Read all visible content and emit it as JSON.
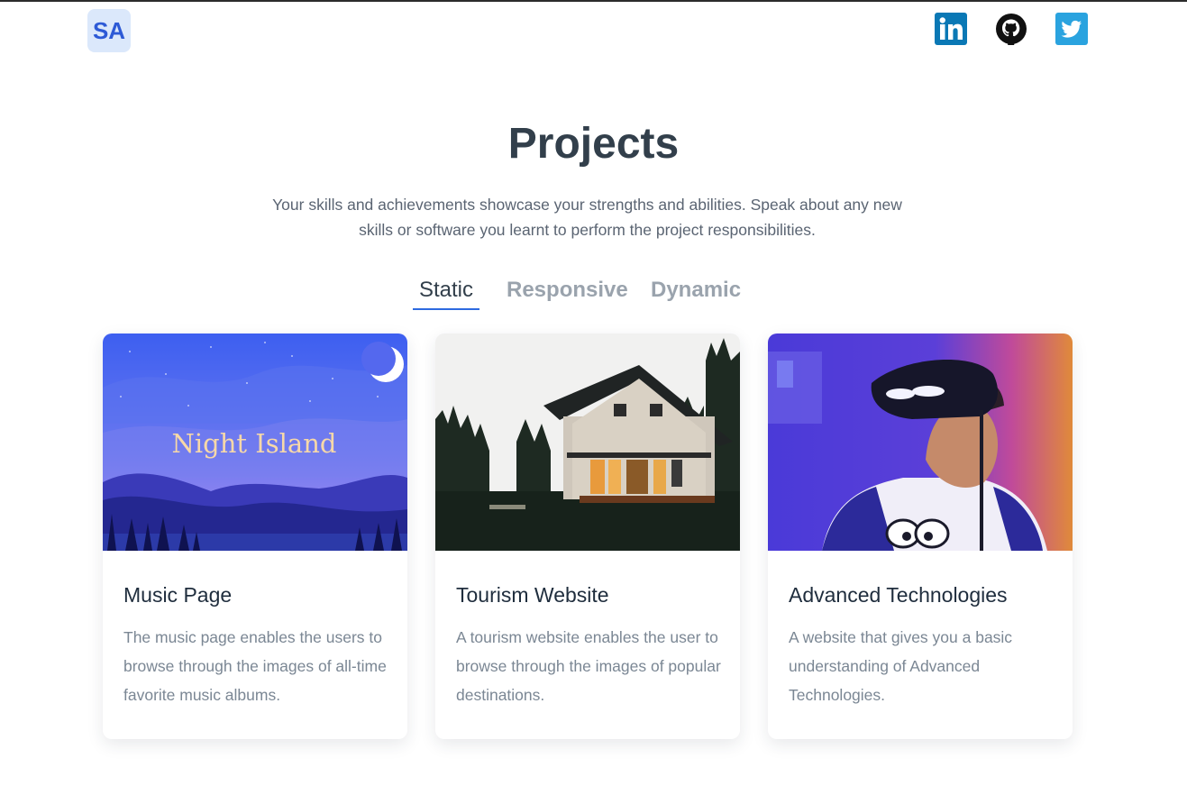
{
  "header": {
    "logo_text": "SA",
    "social": [
      {
        "name": "linkedin-icon",
        "color": "#0a78b5"
      },
      {
        "name": "github-icon",
        "color": "#111111"
      },
      {
        "name": "twitter-icon",
        "color": "#2aa3df"
      }
    ]
  },
  "section": {
    "title": "Projects",
    "subtitle": "Your skills and achievements showcase your strengths and abilities. Speak about any new skills or software you learnt to perform the project responsibilities."
  },
  "tabs": [
    {
      "label": "Static",
      "active": true
    },
    {
      "label": "Responsive",
      "active": false
    },
    {
      "label": "Dynamic",
      "active": false
    }
  ],
  "cards": [
    {
      "image_text": "Night Island",
      "title": "Music Page",
      "description": "The music page enables the users to browse through the images of all-time favorite music albums."
    },
    {
      "title": "Tourism Website",
      "description": "A tourism website enables the user to browse through the images of popular destinations."
    },
    {
      "title": "Advanced Technologies",
      "description": "A website that gives you a basic understanding of Advanced Technologies."
    }
  ],
  "colors": {
    "accent": "#2d6ae0",
    "heading": "#323f4b",
    "muted": "#7b8794",
    "logo_bg": "#dbe8fb"
  }
}
